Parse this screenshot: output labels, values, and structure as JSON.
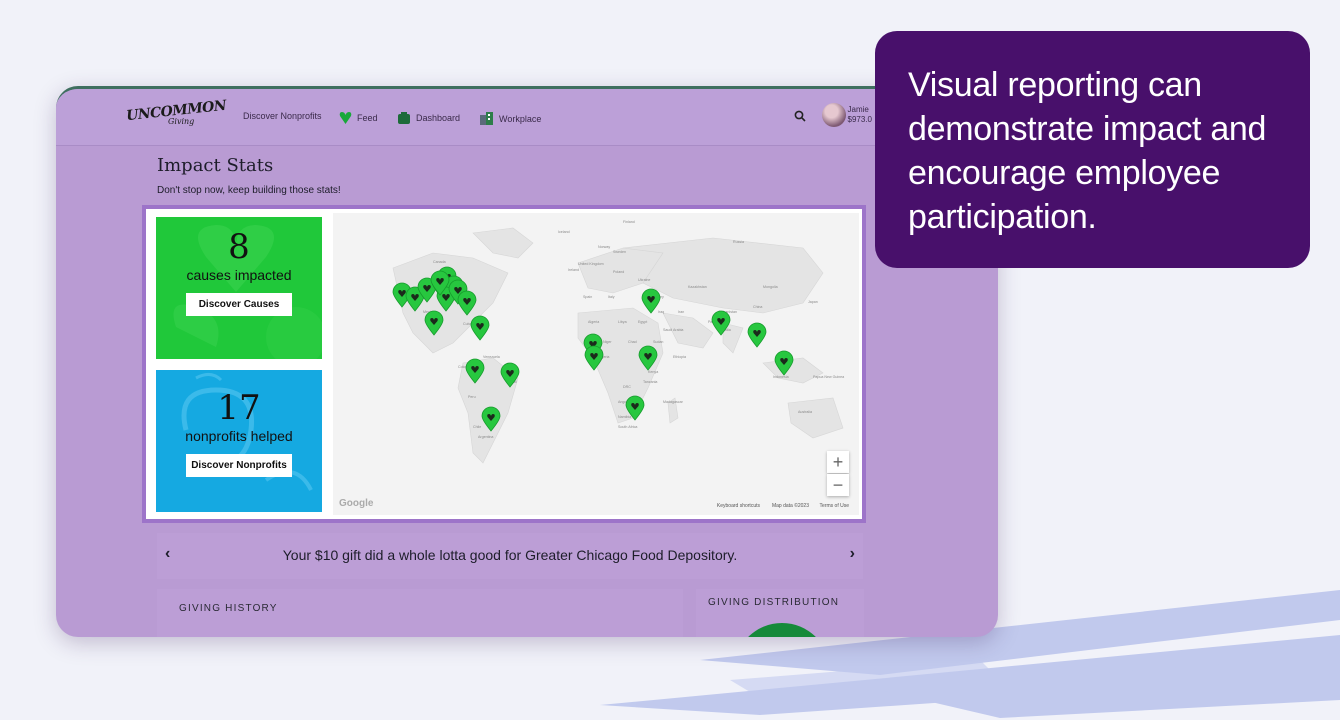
{
  "brand": {
    "name": "UNCOMMON",
    "sub": "Giving"
  },
  "nav": {
    "items": [
      {
        "label": "Discover Nonprofits",
        "icon": ""
      },
      {
        "label": "Feed",
        "icon": "heart-icon"
      },
      {
        "label": "Dashboard",
        "icon": "dashboard-icon"
      },
      {
        "label": "Workplace",
        "icon": "building-icon"
      }
    ],
    "search_icon": "search-icon",
    "user": {
      "name": "Jamie",
      "balance": "$973.0"
    }
  },
  "page": {
    "title": "Impact Stats",
    "subtitle": "Don't stop now, keep building those stats!"
  },
  "stats": {
    "causes": {
      "value": "8",
      "label": "causes impacted",
      "button": "Discover Causes",
      "color": "#20c83a"
    },
    "nonprofits": {
      "value": "17",
      "label": "nonprofits helped",
      "button": "Discover Nonprofits",
      "color": "#15a9e1"
    }
  },
  "map": {
    "labels": [
      "Iceland",
      "Finland",
      "Norway",
      "Sweden",
      "United Kingdom",
      "Ireland",
      "Poland",
      "Ukraine",
      "Russia",
      "Kazakhstan",
      "Spain",
      "Italy",
      "Turkey",
      "Algeria",
      "Libya",
      "Egypt",
      "Iraq",
      "Iran",
      "Afghanistan",
      "Pakistan",
      "China",
      "India",
      "Japan",
      "Mongolia",
      "Saudi Arabia",
      "Niger",
      "Chad",
      "Sudan",
      "Nigeria",
      "Ethiopia",
      "DRC",
      "Kenya",
      "Tanzania",
      "Angola",
      "Namibia",
      "South Africa",
      "Madagascar",
      "Indonesia",
      "Papua New Guinea",
      "Australia",
      "Canada",
      "Venezuela",
      "Colombia",
      "Peru",
      "Brazil",
      "Bolivia",
      "Chile",
      "Argentina",
      "Mexico",
      "Cuba"
    ],
    "pin_count": 23,
    "pin_color": "#27c73f",
    "zoom_in": "+",
    "zoom_out": "−",
    "google": "Google",
    "keyboard": "Keyboard shortcuts",
    "map_data": "Map data ©2023",
    "terms": "Terms of Use"
  },
  "banner": {
    "message": "Your $10 gift did a whole lotta good for Greater Chicago Food Depository.",
    "prev": "‹",
    "next": "›"
  },
  "sections": {
    "history": "GIVING HISTORY",
    "distribution": "GIVING DISTRIBUTION"
  },
  "callout": {
    "text": "Visual reporting can demonstrate impact and encourage employee participation.",
    "bg": "#48106b"
  }
}
